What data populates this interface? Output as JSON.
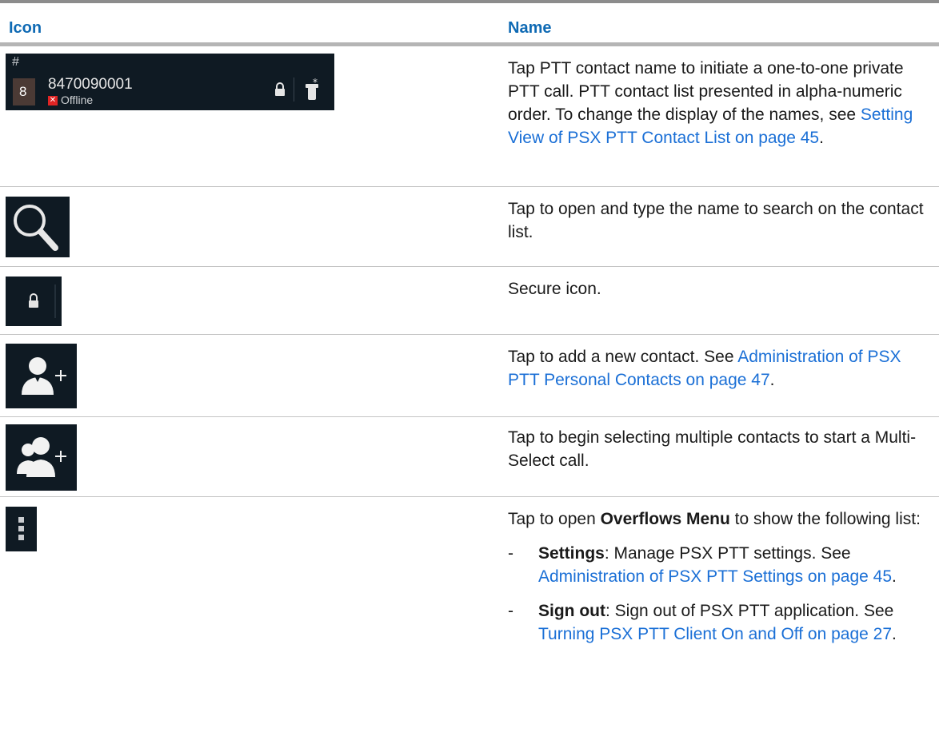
{
  "header": {
    "col_icon": "Icon",
    "col_name": "Name"
  },
  "contact_row": {
    "icon": {
      "section_label": "#",
      "avatar_initial": "8",
      "contact_number": "8470090001",
      "status": "Offline",
      "icons": [
        "lock-icon",
        "settings-badge-icon"
      ]
    },
    "desc_text": "Tap PTT contact name to initiate a one-to-one private PTT call. PTT contact list presented in alpha-numeric order. To change the display of the names, see ",
    "desc_link": "Setting View of PSX PTT Contact List on page 45",
    "desc_end": "."
  },
  "search_row": {
    "icon": "search-icon",
    "desc": "Tap to open and type the name to search on the contact list."
  },
  "secure_row": {
    "icon": "lock-icon",
    "desc": "Secure icon."
  },
  "add_contact_row": {
    "icon": "add-contact-icon",
    "desc_text": "Tap to add a new contact. See ",
    "desc_link": "Administration of PSX PTT Personal Contacts on page 47",
    "desc_end": "."
  },
  "multi_select_row": {
    "icon": "add-group-icon",
    "desc": "Tap to begin selecting multiple contacts to start a Multi-Select call."
  },
  "overflow_row": {
    "icon": "overflow-menu-icon",
    "desc_pre": "Tap to open ",
    "desc_bold": "Overflows Menu",
    "desc_post": " to show the following list:",
    "items": [
      {
        "dash": "-",
        "bold": "Settings",
        "text": ": Manage PSX PTT settings. See ",
        "link": "Administration of PSX PTT Settings on page 45",
        "end": "."
      },
      {
        "dash": "-",
        "bold": "Sign out",
        "text": ": Sign out of PSX PTT application. See ",
        "link": "Turning PSX PTT Client On and Off on page 27",
        "end": "."
      }
    ]
  },
  "colors": {
    "header_text": "#0f6ab4",
    "link": "#1a6fd6",
    "icon_bg": "#0f1a23"
  }
}
